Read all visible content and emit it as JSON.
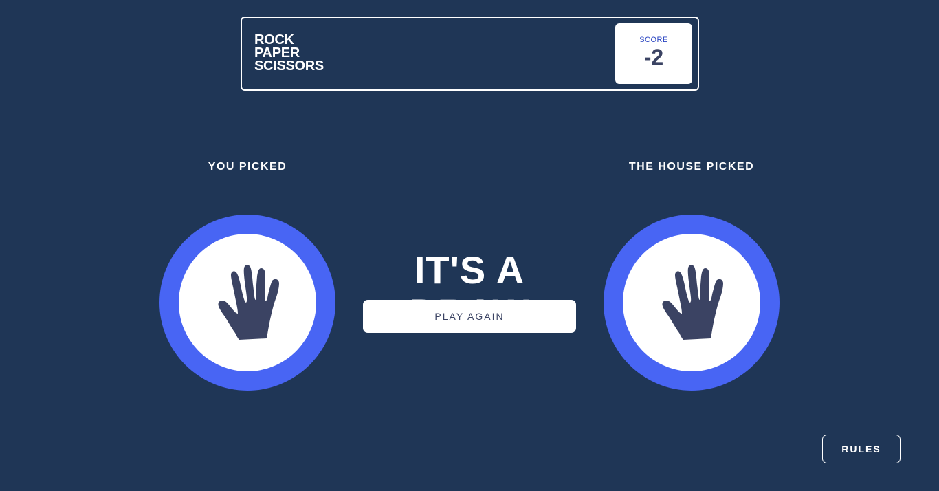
{
  "header": {
    "title_lines": [
      "ROCK",
      "PAPER",
      "SCISSORS"
    ],
    "score_label": "SCORE",
    "score_value": "-2"
  },
  "game": {
    "you_picked_label": "YOU PICKED",
    "house_picked_label": "THE HOUSE PICKED",
    "player_choice": "paper",
    "house_choice": "paper",
    "result_text": "IT'S A DRAW",
    "play_again_label": "PLAY AGAIN"
  },
  "footer": {
    "rules_label": "RULES"
  },
  "colors": {
    "background": "#1f3656",
    "paper_ring": "#4865f4",
    "icon": "#3b4363",
    "white": "#ffffff"
  },
  "icons": {
    "player_icon": "paper-hand-icon",
    "house_icon": "paper-hand-icon"
  }
}
